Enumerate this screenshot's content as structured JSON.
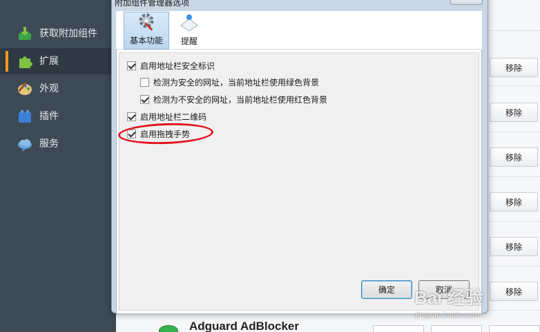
{
  "sidebar": {
    "items": [
      {
        "label": "获取附加组件",
        "icon": "download-addon-icon",
        "color": "#3ea34a"
      },
      {
        "label": "扩展",
        "icon": "puzzle-icon",
        "color": "#7cc242",
        "active": true
      },
      {
        "label": "外观",
        "icon": "palette-icon",
        "color": "#d9a441"
      },
      {
        "label": "插件",
        "icon": "plugin-block-icon",
        "color": "#3b7fd6"
      },
      {
        "label": "服务",
        "icon": "cloud-service-icon",
        "color": "#6aa6de"
      }
    ]
  },
  "dialog": {
    "title": "附加组件管理器选项",
    "tabs": [
      {
        "label": "基本功能",
        "icon": "gear-icon",
        "active": true
      },
      {
        "label": "提醒",
        "icon": "notification-icon",
        "active": false
      }
    ],
    "options": [
      {
        "label": "启用地址栏安全标识",
        "checked": true,
        "indent": 0
      },
      {
        "label": "检测为安全的网址，当前地址栏使用绿色背景",
        "checked": false,
        "indent": 1
      },
      {
        "label": "检测为不安全的网址，当前地址栏使用红色背景",
        "checked": true,
        "indent": 1
      },
      {
        "label": "启用地址栏二维码",
        "checked": true,
        "indent": 0
      },
      {
        "label": "启用拖拽手势",
        "checked": true,
        "indent": 0,
        "highlighted": true
      }
    ],
    "ok_label": "确定",
    "cancel_label": "取消"
  },
  "extensions": {
    "remove_label": "移除",
    "visible_item_name": "Adguard AdBlocker"
  },
  "watermark": {
    "text": "Bai 经验",
    "url": "jingyan.baidu.com"
  },
  "colors": {
    "accent": "#f39a1e",
    "highlight": "#e3121b",
    "sidebar_bg": "#3d4a56"
  }
}
